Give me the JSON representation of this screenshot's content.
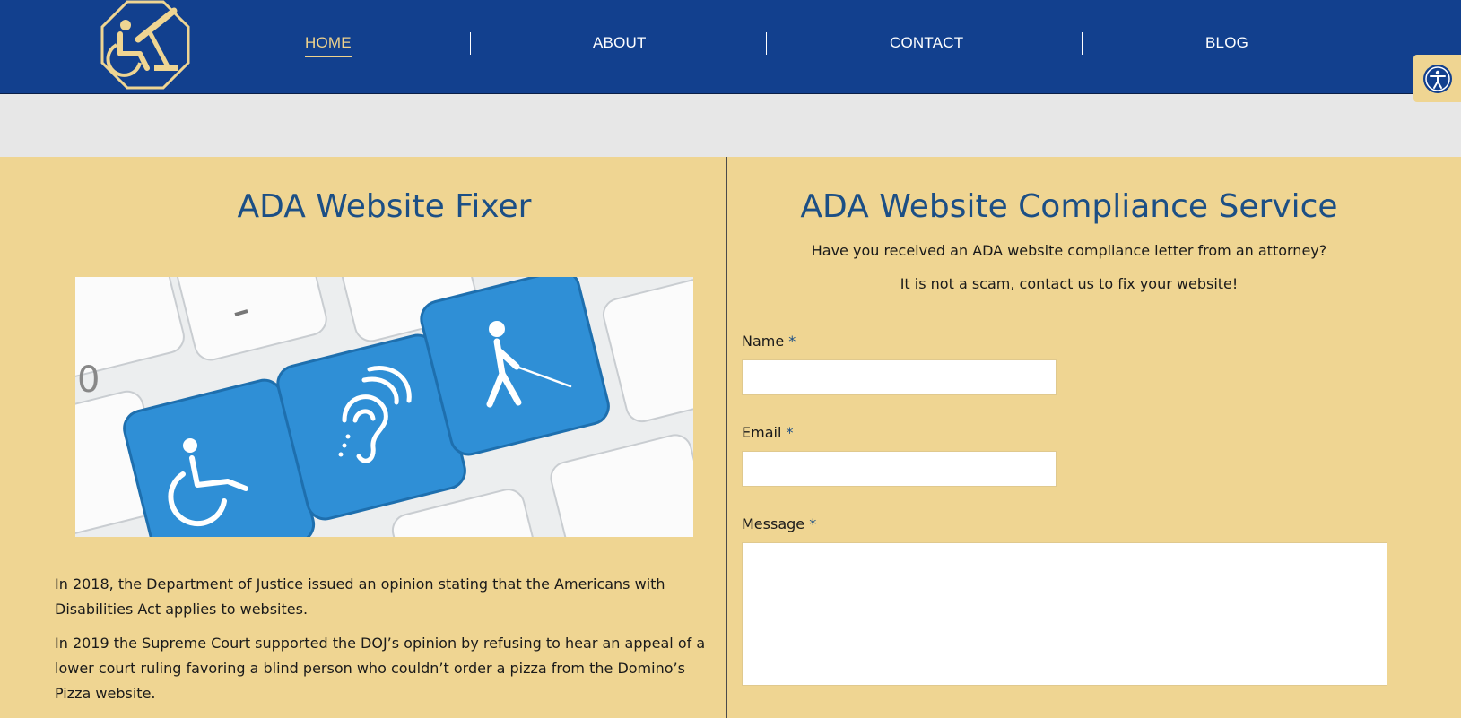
{
  "header": {
    "logo_alt": "wheelchair-logo",
    "nav": [
      {
        "label": "HOME"
      },
      {
        "label": "ABOUT"
      },
      {
        "label": "CONTACT"
      },
      {
        "label": "BLOG"
      }
    ],
    "accessibility_icon": "accessibility-icon"
  },
  "left": {
    "title": "ADA Website Fixer",
    "image_icons": [
      "wheelchair-icon",
      "hearing-icon",
      "blind-person-icon"
    ],
    "paragraphs": [
      "In 2018, the Department of Justice issued an opinion stating that the Americans with Disabilities Act applies to websites.",
      "In 2019 the Supreme Court supported the DOJ’s opinion by refusing to hear an appeal of a lower court ruling favoring a blind person who couldn’t order a pizza from the Domino’s Pizza website."
    ]
  },
  "right": {
    "title": "ADA Website Compliance Service",
    "subtitle1": "Have you received an ADA website compliance letter from an attorney?",
    "subtitle2": "It is not a scam, contact us to fix your website!",
    "form": {
      "name_label": "Name",
      "email_label": "Email",
      "message_label": "Message",
      "required_mark": "*",
      "name_value": "",
      "email_value": "",
      "message_value": ""
    }
  },
  "colors": {
    "header_bg": "#12408e",
    "accent_gold": "#efd592",
    "title_blue": "#1c4f85",
    "key_blue": "#2f8fd6"
  }
}
